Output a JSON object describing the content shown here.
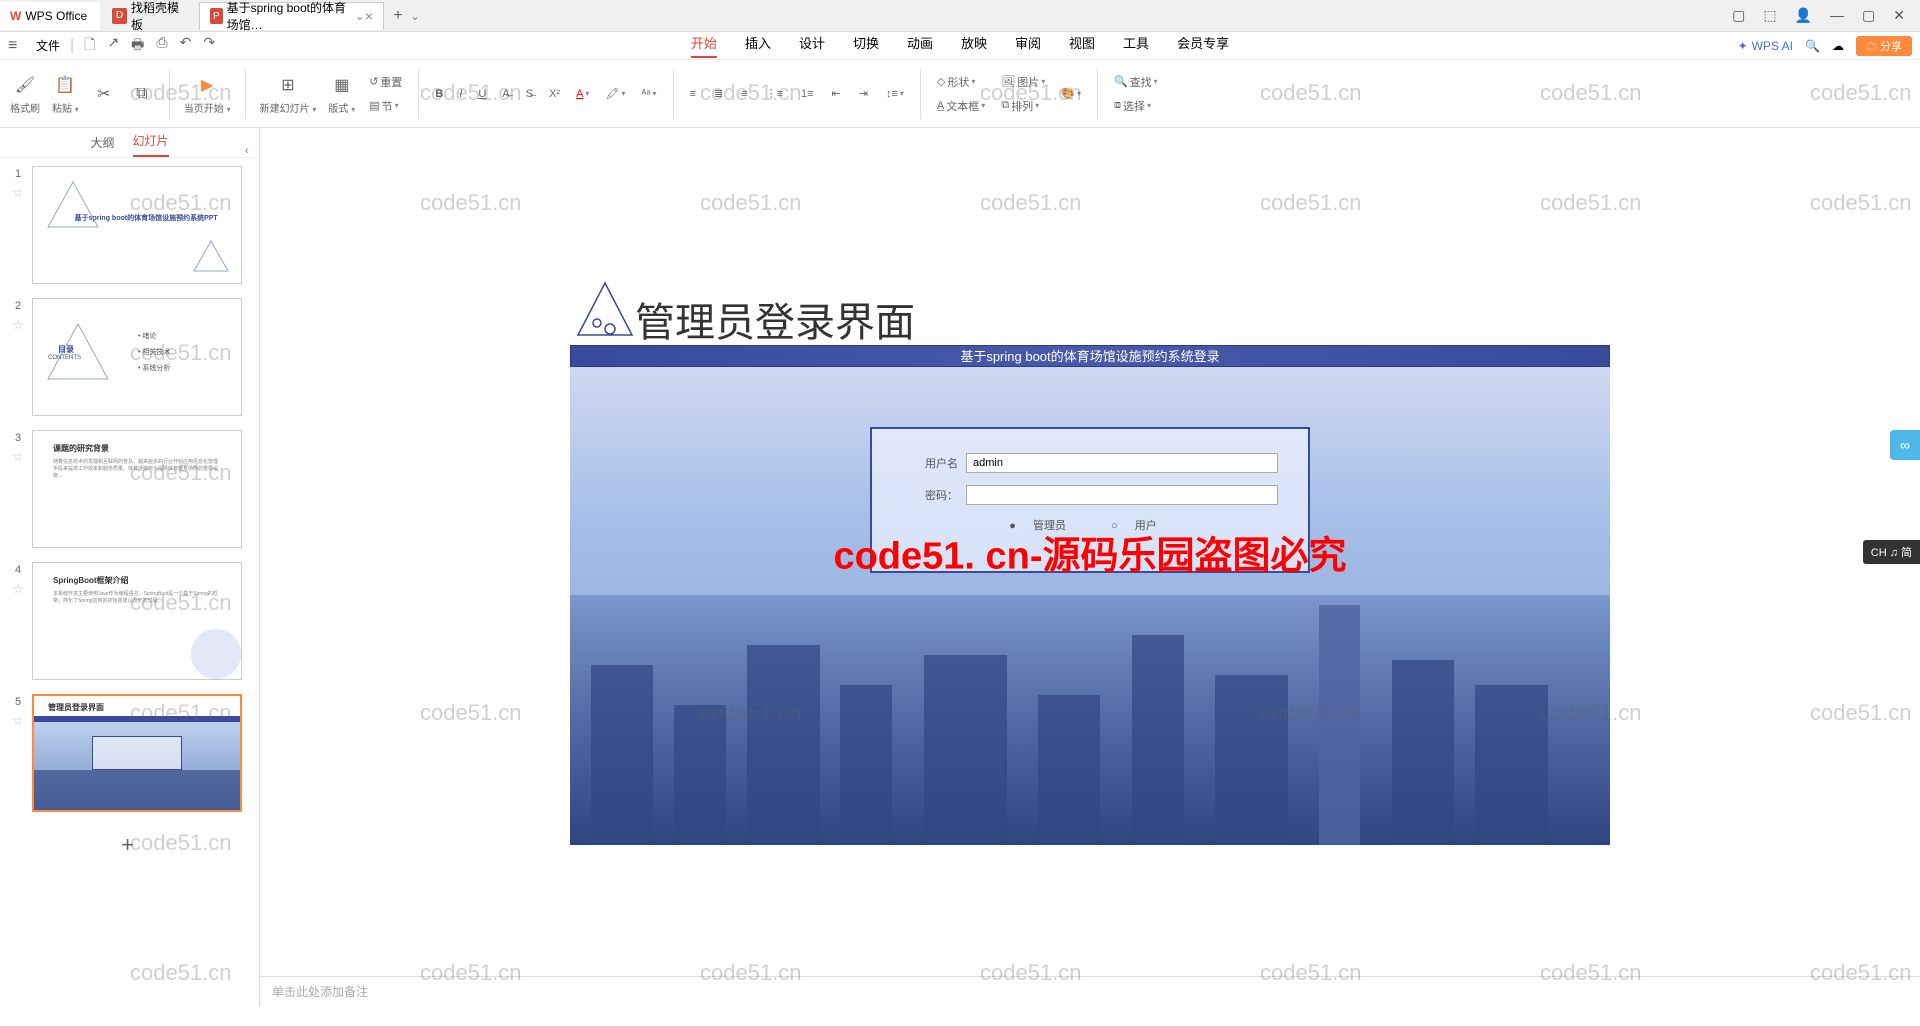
{
  "tabbar": {
    "home_label": "WPS Office",
    "template_label": "找稻壳模板",
    "doc_label": "基于spring boot的体育场馆…",
    "doc_icon": "P",
    "close": "×",
    "add": "+",
    "dropdown": "⌄"
  },
  "window_controls": {
    "layout": "▢",
    "cube": "⬚",
    "user": "👤",
    "min": "—",
    "max": "▢",
    "close": "✕"
  },
  "filemenu": {
    "hamburger": "≡",
    "file": "文件",
    "qat": [
      "🗋",
      "↗",
      "🖶",
      "⎙",
      "↶",
      "↷"
    ]
  },
  "ribbon_tabs": [
    "开始",
    "插入",
    "设计",
    "切换",
    "动画",
    "放映",
    "审阅",
    "视图",
    "工具",
    "会员专享"
  ],
  "ribbon_right": {
    "wps_ai": "WPS AI",
    "search_icon": "🔍",
    "cloud": "☁",
    "share": "分享",
    "collapse": "⌃"
  },
  "ribbon": {
    "format_painter": "格式刷",
    "paste": "粘贴",
    "from_current": "当页开始",
    "new_slide": "新建幻灯片",
    "layout": "版式",
    "reset": "重置",
    "section": "节",
    "shape": "形状",
    "picture": "图片",
    "textbox": "文本框",
    "arrange": "排列",
    "find": "查找",
    "select": "选择"
  },
  "leftpanel": {
    "outline": "大纲",
    "slides": "幻灯片",
    "collapse": "‹"
  },
  "thumbs": [
    {
      "num": "1",
      "title": "基于spring boot的体育场馆设施预约系统PPT"
    },
    {
      "num": "2",
      "contents_label": "目录",
      "contents_en": "CONTENTS",
      "items": [
        "绪论",
        "相关技术",
        "系统分析"
      ]
    },
    {
      "num": "3",
      "heading": "课题的研究背景"
    },
    {
      "num": "4",
      "heading": "SpringBoot框架介绍"
    },
    {
      "num": "5",
      "heading": "管理员登录界面"
    }
  ],
  "slide": {
    "title": "管理员登录界面",
    "banner": "基于spring boot的体育场馆设施预约系统登录",
    "username_label": "用户名",
    "username_value": "admin",
    "password_label": "密码：",
    "role_admin": "管理员",
    "role_user": "用户"
  },
  "notes": "单击此处添加备注",
  "watermark_text": "code51.cn",
  "big_watermark": "code51. cn-源码乐园盗图必究",
  "ime": "CH ♫ 简"
}
